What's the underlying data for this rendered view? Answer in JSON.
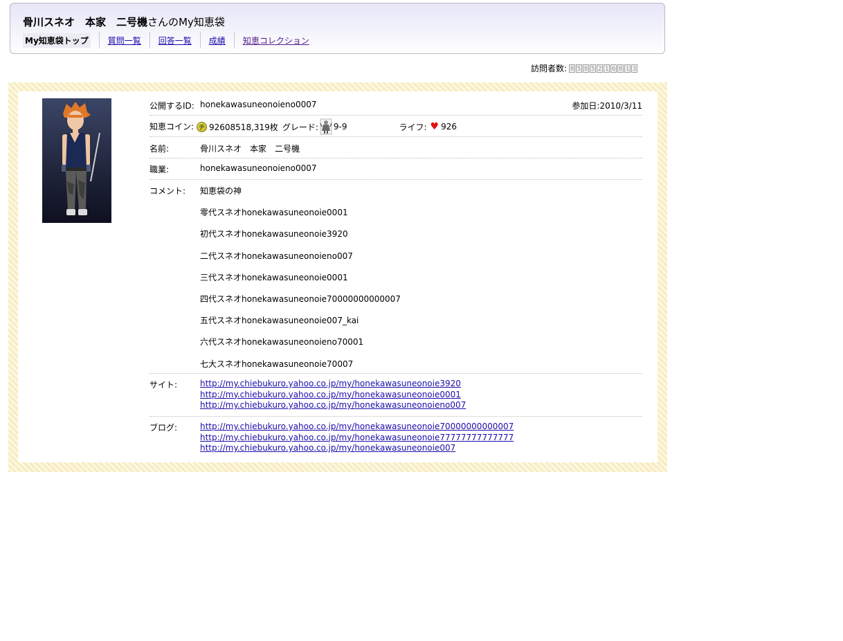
{
  "header": {
    "user_name": "骨川スネオ　本家　二号機",
    "title_suffix": "さんのMy知恵袋",
    "tabs": [
      {
        "label": "My知恵袋トップ"
      },
      {
        "label": "質問一覧"
      },
      {
        "label": "回答一覧"
      },
      {
        "label": "成績"
      },
      {
        "label": "知恵コレクション"
      }
    ]
  },
  "visitor": {
    "label": "訪問者数:",
    "digits": [
      "8",
      "5",
      "8",
      "5",
      "2",
      "1",
      "6",
      "8",
      "1",
      "3"
    ]
  },
  "profile": {
    "id_label": "公開するID:",
    "id_value": "honekawasuneonoieno0007",
    "join_label": "参加日:",
    "join_date": "2010/3/11",
    "coin_label": "知恵コイン:",
    "coin_icon": "チ",
    "coin_value": "92608518,319枚",
    "grade_label": "グレード:",
    "grade_value": "9-9",
    "life_label": "ライフ:",
    "life_value": "926",
    "name_label": "名前:",
    "name_value": "骨川スネオ　本家　二号機",
    "job_label": "職業:",
    "job_value": "honekawasuneonoieno0007",
    "comment_label": "コメント:",
    "comment_lines": [
      "知恵袋の神",
      "零代スネオhonekawasuneonoie0001",
      "初代スネオhonekawasuneonoie3920",
      "二代スネオhonekawasuneonoieno007",
      "三代スネオhonekawasuneonoie0001",
      "四代スネオhonekawasuneonoie70000000000007",
      "五代スネオhonekawasuneonoie007_kai",
      "六代スネオhonekawasuneonoieno70001",
      "七大スネオhonekawasuneonoie70007"
    ],
    "site_label": "サイト:",
    "site_links": [
      "http://my.chiebukuro.yahoo.co.jp/my/honekawasuneonoie3920",
      "http://my.chiebukuro.yahoo.co.jp/my/honekawasuneonoie0001",
      "http://my.chiebukuro.yahoo.co.jp/my/honekawasuneonoieno007"
    ],
    "blog_label": "ブログ:",
    "blog_links": [
      "http://my.chiebukuro.yahoo.co.jp/my/honekawasuneonoie70000000000007",
      "http://my.chiebukuro.yahoo.co.jp/my/honekawasuneonoie77777777777777",
      "http://my.chiebukuro.yahoo.co.jp/my/honekawasuneonoie007"
    ]
  },
  "colors": {
    "link": "#1a0dab",
    "visited_link": "#551a8b",
    "header_bg": "#e6e6f7",
    "frame_stripe": "#f7ecbf",
    "heart": "#e01010"
  }
}
